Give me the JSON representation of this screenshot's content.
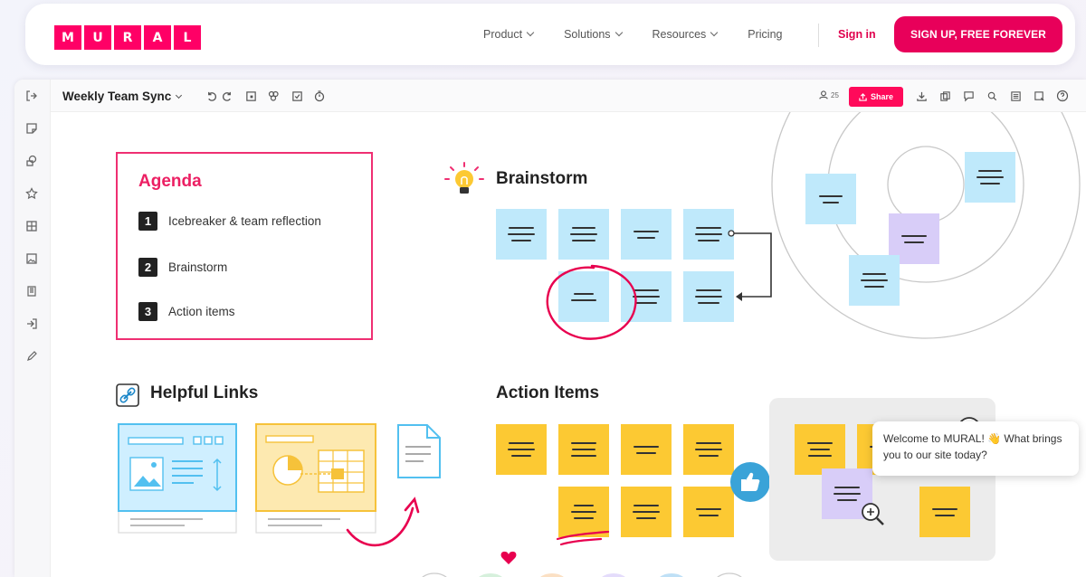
{
  "nav": {
    "logo_letters": [
      "M",
      "U",
      "R",
      "A",
      "L"
    ],
    "links": [
      {
        "label": "Product"
      },
      {
        "label": "Solutions"
      },
      {
        "label": "Resources"
      },
      {
        "label": "Pricing"
      }
    ],
    "signin": "Sign in",
    "signup": "SIGN UP, FREE FOREVER"
  },
  "toolbar": {
    "board_title": "Weekly Team Sync",
    "share_label": "Share",
    "user_count": "25"
  },
  "agenda": {
    "title": "Agenda",
    "items": [
      {
        "num": "1",
        "label": "Icebreaker & team reflection"
      },
      {
        "num": "2",
        "label": "Brainstorm"
      },
      {
        "num": "3",
        "label": "Action items"
      }
    ]
  },
  "brainstorm": {
    "title": "Brainstorm"
  },
  "helpful_links": {
    "title": "Helpful Links"
  },
  "action_items": {
    "title": "Action Items"
  },
  "chat": {
    "message": "Welcome to MURAL! 👋 What brings you to our site today?"
  },
  "colors": {
    "brand": "#ff0066",
    "sticky_blue": "#bfe9fb",
    "sticky_yellow": "#fcc933",
    "sticky_purple": "#d8cdf8"
  },
  "icons": {
    "lefttool": [
      "exit-icon",
      "sticky-note-icon",
      "shapes-icon",
      "star-icon",
      "grid-icon",
      "image-icon",
      "template-icon",
      "import-icon",
      "pen-icon"
    ],
    "toolbar": [
      "undo-icon",
      "redo-icon",
      "frame-icon",
      "group-icon",
      "checkbox-icon",
      "timer-icon"
    ],
    "toolbar_right": [
      "download-icon",
      "copy-icon",
      "comment-icon",
      "tag-icon",
      "list-icon",
      "search-icon",
      "help-icon"
    ]
  }
}
